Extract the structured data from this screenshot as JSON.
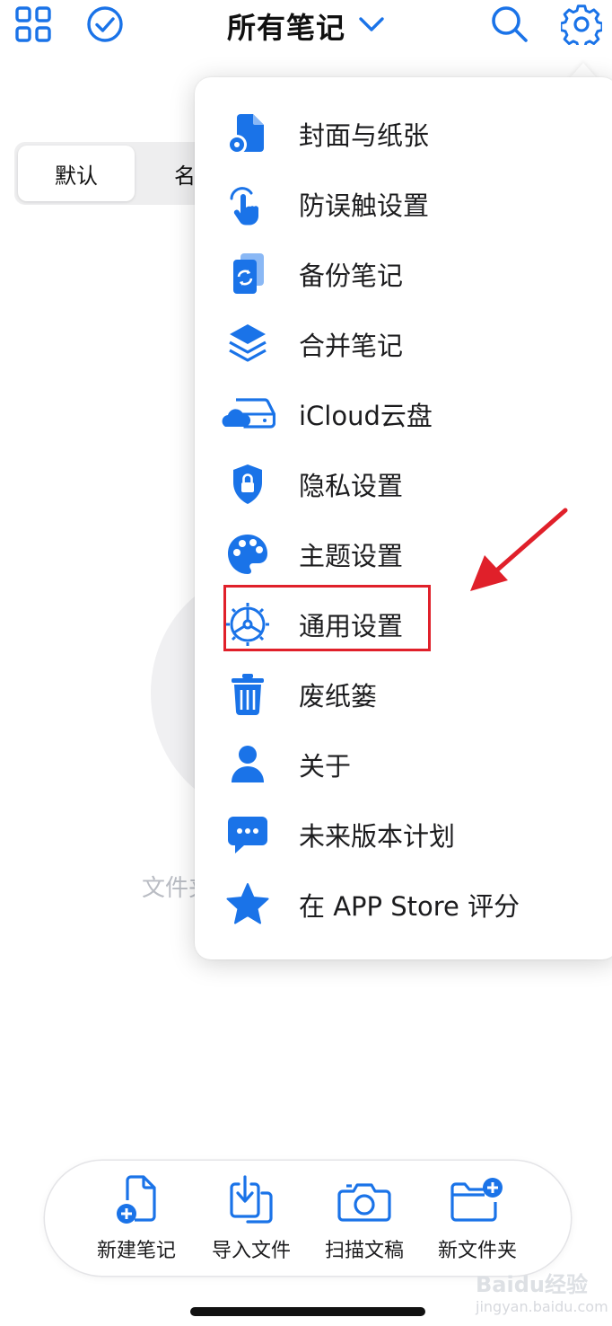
{
  "topbar": {
    "title": "所有笔记",
    "left_icons": [
      "grid-icon",
      "check-circle-icon"
    ],
    "right_icons": [
      "search-icon",
      "gear-icon"
    ],
    "accent": "#1a73e8"
  },
  "sort_control": {
    "options": [
      "默认",
      "名称"
    ],
    "selected": "默认"
  },
  "empty_state": {
    "text": "文件夹"
  },
  "menu": {
    "items": [
      {
        "label": "封面与纸张",
        "icon": "document-gear-icon"
      },
      {
        "label": "防误触设置",
        "icon": "touch-hand-icon"
      },
      {
        "label": "备份笔记",
        "icon": "backup-sync-icon"
      },
      {
        "label": "合并笔记",
        "icon": "layers-icon"
      },
      {
        "label": "iCloud云盘",
        "icon": "cloud-drive-icon"
      },
      {
        "label": "隐私设置",
        "icon": "shield-lock-icon"
      },
      {
        "label": "主题设置",
        "icon": "palette-icon"
      },
      {
        "label": "通用设置",
        "icon": "settings-wheel-icon"
      },
      {
        "label": "废纸篓",
        "icon": "trash-icon"
      },
      {
        "label": "关于",
        "icon": "person-icon"
      },
      {
        "label": "未来版本计划",
        "icon": "chat-bubble-icon"
      },
      {
        "label": "在 APP Store 评分",
        "icon": "star-icon"
      }
    ],
    "highlighted": "通用设置",
    "highlight_color": "#e0202a"
  },
  "toolbar": {
    "items": [
      {
        "label": "新建笔记",
        "icon": "new-note-icon"
      },
      {
        "label": "导入文件",
        "icon": "import-file-icon"
      },
      {
        "label": "扫描文稿",
        "icon": "camera-scan-icon"
      },
      {
        "label": "新文件夹",
        "icon": "new-folder-icon"
      }
    ]
  },
  "watermark": {
    "brand": "Baidu经验",
    "url": "jingyan.baidu.com"
  }
}
